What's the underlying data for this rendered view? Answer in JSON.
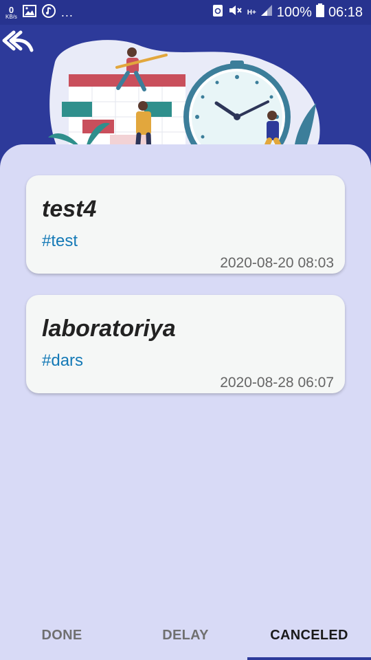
{
  "status_bar": {
    "speed_value": "0",
    "speed_unit": "KB/s",
    "overflow": "...",
    "network": "H+",
    "battery": "100%",
    "time": "06:18"
  },
  "header": {
    "back_icon": "double-back-arrow-icon",
    "accent": "#2d3a9a"
  },
  "tasks": [
    {
      "title": "test4",
      "tag": "#test",
      "date": "2020-08-20 08:03"
    },
    {
      "title": "laboratoriya",
      "tag": "#dars",
      "date": "2020-08-28 06:07"
    }
  ],
  "tabs": [
    {
      "label": "DONE",
      "active": false
    },
    {
      "label": "DELAY",
      "active": false
    },
    {
      "label": "CANCELED",
      "active": true
    }
  ]
}
